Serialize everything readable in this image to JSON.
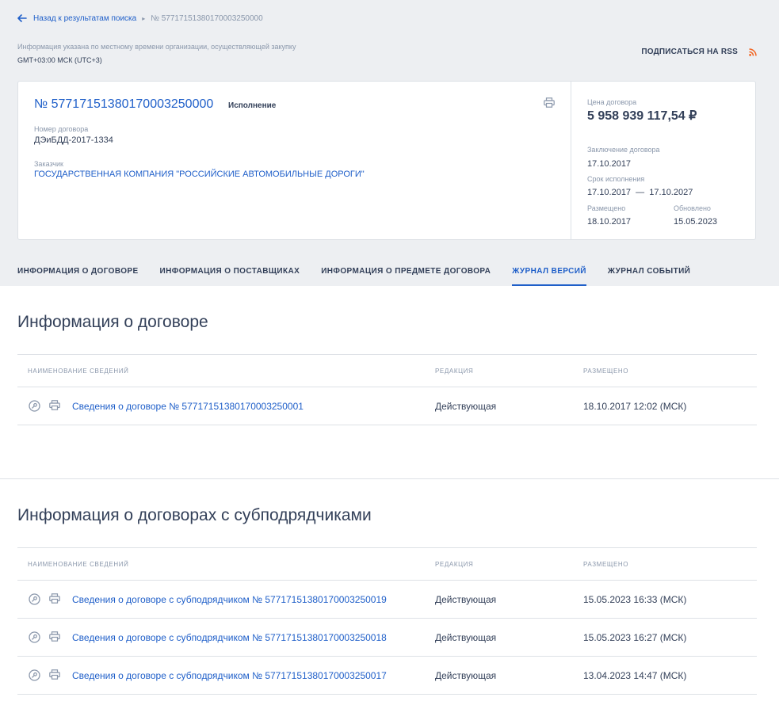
{
  "breadcrumb": {
    "back_label": "Назад к результатам поиска",
    "current": "№ 57717151380170003250000"
  },
  "timezone": {
    "note": "Информация указана по местному времени организации, осуществляющей закупку",
    "value": "GMT+03:00 МСК (UTC+3)"
  },
  "rss": {
    "label": "ПОДПИСАТЬСЯ НА RSS",
    "icon": "rss-icon",
    "color": "#f26522"
  },
  "card": {
    "number": "№ 57717151380170003250000",
    "status": "Исполнение",
    "contract_no_label": "Номер договора",
    "contract_no": "ДЭиБДД-2017-1334",
    "customer_label": "Заказчик",
    "customer": "ГОСУДАРСТВЕННАЯ КОМПАНИЯ \"РОССИЙСКИЕ АВТОМОБИЛЬНЫЕ ДОРОГИ\"",
    "price_label": "Цена договора",
    "price": "5 958 939 117,54 ₽",
    "conclusion_label": "Заключение договора",
    "conclusion_date": "17.10.2017",
    "term_label": "Срок исполнения",
    "term_value": "17.10.2017  —  17.10.2027",
    "posted_label": "Размещено",
    "posted_date": "18.10.2017",
    "updated_label": "Обновлено",
    "updated_date": "15.05.2023"
  },
  "tabs": [
    {
      "label": "ИНФОРМАЦИЯ О ДОГОВОРЕ",
      "active": false
    },
    {
      "label": "ИНФОРМАЦИЯ О ПОСТАВЩИКАХ",
      "active": false
    },
    {
      "label": "ИНФОРМАЦИЯ О ПРЕДМЕТЕ ДОГОВОРА",
      "active": false
    },
    {
      "label": "ЖУРНАЛ ВЕРСИЙ",
      "active": true
    },
    {
      "label": "ЖУРНАЛ СОБЫТИЙ",
      "active": false
    }
  ],
  "section1": {
    "title": "Информация о договоре",
    "headers": [
      "НАИМЕНОВАНИЕ СВЕДЕНИЙ",
      "РЕДАКЦИЯ",
      "РАЗМЕЩЕНО"
    ],
    "rows": [
      {
        "name": "Сведения о договоре № 57717151380170003250001",
        "edition": "Действующая",
        "posted": "18.10.2017 12:02 (МСК)"
      }
    ]
  },
  "section2": {
    "title": "Информация о договорах с субподрядчиками",
    "headers": [
      "НАИМЕНОВАНИЕ СВЕДЕНИЙ",
      "РЕДАКЦИЯ",
      "РАЗМЕЩЕНО"
    ],
    "rows": [
      {
        "name": "Сведения о договоре с субподрядчиком № 57717151380170003250019",
        "edition": "Действующая",
        "posted": "15.05.2023 16:33 (МСК)"
      },
      {
        "name": "Сведения о договоре с субподрядчиком № 57717151380170003250018",
        "edition": "Действующая",
        "posted": "15.05.2023 16:27 (МСК)"
      },
      {
        "name": "Сведения о договоре с субподрядчиком № 57717151380170003250017",
        "edition": "Действующая",
        "posted": "13.04.2023 14:47 (МСК)"
      }
    ]
  },
  "colors": {
    "accent": "#1f5fc9",
    "text": "#334059",
    "muted": "#8a97ab",
    "background": "#edeff2"
  }
}
